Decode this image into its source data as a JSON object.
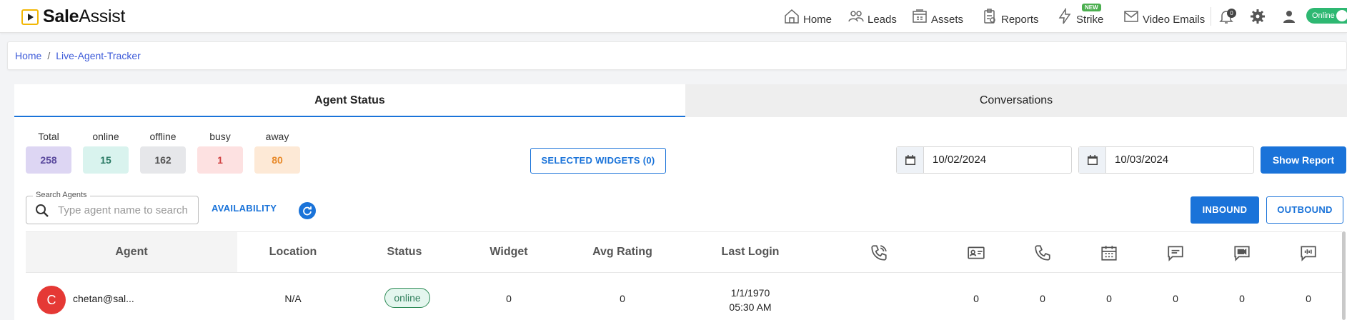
{
  "brand": {
    "name_bold": "Sale",
    "name_rest": "Assist"
  },
  "nav": {
    "home": "Home",
    "leads": "Leads",
    "assets": "Assets",
    "reports": "Reports",
    "strike": "Strike",
    "strike_badge": "NEW",
    "video_emails": "Video Emails",
    "notification_count": "0",
    "status_toggle": "Online"
  },
  "breadcrumb": {
    "home": "Home",
    "separator": "/",
    "current": "Live-Agent-Tracker"
  },
  "tabs": {
    "agent_status": "Agent Status",
    "conversations": "Conversations"
  },
  "counters": [
    {
      "label": "Total",
      "value": "258",
      "bg": "#ddd6f3",
      "color": "#5b4a9e"
    },
    {
      "label": "online",
      "value": "15",
      "bg": "#d9f3ee",
      "color": "#2a7a64"
    },
    {
      "label": "offline",
      "value": "162",
      "bg": "#e6e7ea",
      "color": "#555"
    },
    {
      "label": "busy",
      "value": "1",
      "bg": "#fde1e1",
      "color": "#d04040"
    },
    {
      "label": "away",
      "value": "80",
      "bg": "#fde9d6",
      "color": "#e88a2a"
    }
  ],
  "selected_widgets": "SELECTED WIDGETS (0)",
  "dates": {
    "from": "10/02/2024",
    "to": "10/03/2024"
  },
  "show_report": "Show Report",
  "search": {
    "legend": "Search Agents",
    "placeholder": "Type agent name to search"
  },
  "availability": "AVAILABILITY",
  "direction": {
    "inbound": "INBOUND",
    "outbound": "OUTBOUND"
  },
  "table": {
    "headers": {
      "agent": "Agent",
      "location": "Location",
      "status": "Status",
      "widget": "Widget",
      "avg_rating": "Avg Rating",
      "last_login": "Last Login"
    },
    "icon_columns": [
      "phone-incoming-icon",
      "contact-card-icon",
      "phone-icon",
      "calendar-icon",
      "chat-icon",
      "video-chat-icon",
      "voice-message-icon"
    ],
    "rows": [
      {
        "avatar": "C",
        "agent": "chetan@sal...",
        "location": "N/A",
        "status": "online",
        "widget": "0",
        "avg_rating": "0",
        "last_login_date": "1/1/1970",
        "last_login_time": "05:30 AM",
        "counts": [
          "0",
          "0",
          "0",
          "0",
          "0",
          "0"
        ]
      }
    ]
  }
}
